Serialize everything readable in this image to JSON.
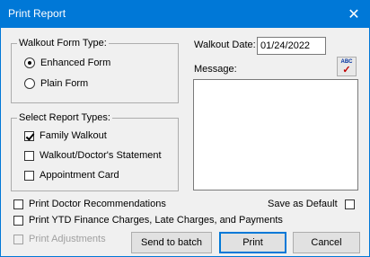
{
  "window": {
    "title": "Print Report"
  },
  "walkout_form_type": {
    "legend": "Walkout Form Type:",
    "options": [
      {
        "label": "Enhanced Form",
        "selected": true
      },
      {
        "label": "Plain Form",
        "selected": false
      }
    ]
  },
  "report_types": {
    "legend": "Select Report Types:",
    "options": [
      {
        "label": "Family Walkout",
        "checked": true
      },
      {
        "label": "Walkout/Doctor's Statement",
        "checked": false
      },
      {
        "label": "Appointment Card",
        "checked": false
      }
    ]
  },
  "walkout_date": {
    "label": "Walkout Date:",
    "value": "01/24/2022"
  },
  "message": {
    "label": "Message:",
    "value": ""
  },
  "spell_check": {
    "icon": "spell-check-icon",
    "text": "ABC"
  },
  "options": {
    "print_doctor_recommendations": {
      "label": "Print Doctor Recommendations",
      "checked": false
    },
    "save_as_default": {
      "label": "Save as Default",
      "checked": false
    },
    "print_ytd": {
      "label": "Print YTD Finance Charges, Late Charges, and Payments",
      "checked": false
    },
    "print_adjustments": {
      "label": "Print Adjustments",
      "checked": false,
      "disabled": true
    }
  },
  "buttons": {
    "send_to_batch": "Send to batch",
    "print": "Print",
    "cancel": "Cancel"
  }
}
